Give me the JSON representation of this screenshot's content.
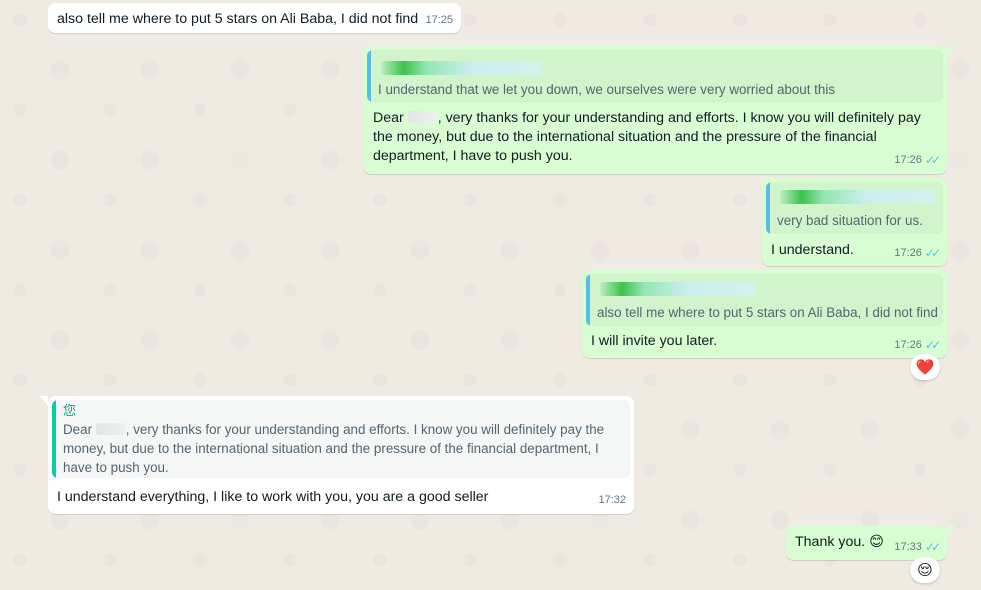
{
  "messages": {
    "m1": {
      "text": "also tell me where to put 5 stars on Ali Baba, I did not find",
      "time": "17:25"
    },
    "m2": {
      "quote_text": "I understand that we let you down, we ourselves were very worried about this",
      "text_before": "Dear ",
      "text_after": ", very thanks for your understanding and efforts. I know you will definitely pay the money, but due to the international situation and the pressure of the financial department, I have to push you.",
      "time": "17:26"
    },
    "m3": {
      "quote_text": "very bad situation for us.",
      "text": "I understand.",
      "time": "17:26"
    },
    "m4": {
      "quote_text": "also tell me where to put 5 stars on Ali Baba, I did not find",
      "text": "I will invite you later.",
      "time": "17:26",
      "reaction": "❤️"
    },
    "m5": {
      "quote_author": "您",
      "quote_before": "Dear ",
      "quote_after": ", very thanks for your understanding and efforts. I know you will definitely pay the money, but due to the international situation and the pressure of the financial department, I have to push you.",
      "text": "I understand everything, I like to work with you, you are a good seller",
      "time": "17:32"
    },
    "m6": {
      "text": "Thank you. 😊",
      "time": "17:33",
      "reaction": "😌"
    }
  },
  "icons": {
    "read_ticks": "✓✓"
  },
  "colors": {
    "incoming_bubble": "#ffffff",
    "outgoing_bubble": "#d9fdd3",
    "quote_bar_outgoing": "#53bdeb",
    "quote_bar_incoming": "#06cf9c",
    "read_ticks": "#53bdeb",
    "background": "#efeae2"
  }
}
